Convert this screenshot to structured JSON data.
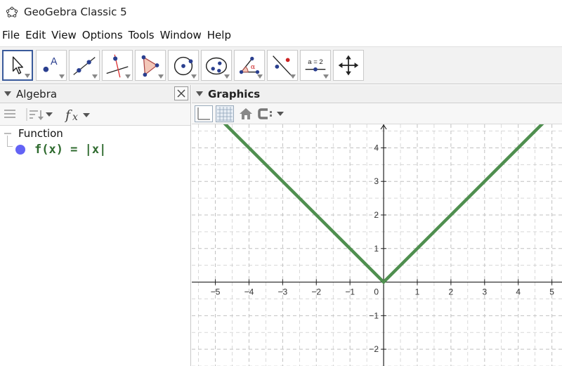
{
  "window": {
    "title": "GeoGebra Classic 5"
  },
  "menu": [
    "File",
    "Edit",
    "View",
    "Options",
    "Tools",
    "Window",
    "Help"
  ],
  "toolbar": {
    "tools": [
      {
        "name": "move-tool",
        "icon": "arrow-cursor-icon",
        "selected": true
      },
      {
        "name": "point-tool",
        "icon": "point-icon",
        "label": "A"
      },
      {
        "name": "line-tool",
        "icon": "line-icon"
      },
      {
        "name": "perpendicular-line-tool",
        "icon": "perpendicular-icon"
      },
      {
        "name": "polygon-tool",
        "icon": "polygon-icon"
      },
      {
        "name": "circle-tool",
        "icon": "circle-center-icon"
      },
      {
        "name": "ellipse-tool",
        "icon": "ellipse-icon"
      },
      {
        "name": "angle-tool",
        "icon": "angle-icon",
        "label": "α"
      },
      {
        "name": "reflect-tool",
        "icon": "reflect-line-icon"
      },
      {
        "name": "slider-tool",
        "icon": "slider-icon",
        "label": "a = 2"
      },
      {
        "name": "move-graphics-tool",
        "icon": "move-cross-icon"
      }
    ]
  },
  "algebra": {
    "title": "Algebra",
    "group": "Function",
    "items": [
      {
        "expression": "f(x) = |x|",
        "color": "#6363f5"
      }
    ]
  },
  "graphics": {
    "title": "Graphics"
  },
  "chart_data": {
    "type": "line",
    "function": "f(x) = |x|",
    "series": [
      {
        "name": "f(x) = |x|",
        "color": "#4f8f4f",
        "x": [
          -5.5,
          0,
          5.5
        ],
        "y": [
          5.5,
          0,
          5.5
        ]
      }
    ],
    "xlim": [
      -5.7,
      5.3
    ],
    "ylim": [
      -2.5,
      4.7
    ],
    "xticks": [
      -5,
      -4,
      -3,
      -2,
      -1,
      1,
      2,
      3,
      4,
      5
    ],
    "yticks": [
      -2,
      -1,
      1,
      2,
      3,
      4
    ],
    "origin_label": "0",
    "grid": true,
    "axis_color": "#222222",
    "grid_color": "#c0c0c0"
  }
}
